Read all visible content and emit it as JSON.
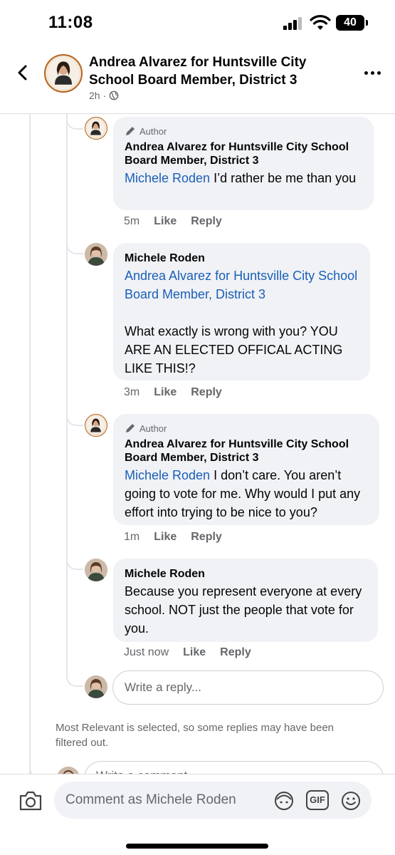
{
  "status_bar": {
    "time": "11:08",
    "battery": "40"
  },
  "header": {
    "title": "Andrea Alvarez for Huntsville City School Board Member, District 3",
    "time_ago": "2h",
    "separator": "·"
  },
  "comments": [
    {
      "badge": "Author",
      "name": "Andrea Alvarez for Huntsville City School Board Member, District 3",
      "mention": "Michele Roden",
      "text": " I’d rather be me than you",
      "time": "5m",
      "like": "Like",
      "reply": "Reply"
    },
    {
      "name": "Michele Roden",
      "mention": "Andrea Alvarez for Huntsville City School Board Member, District 3",
      "text": "What exactly is wrong with you? YOU ARE AN ELECTED OFFICAL ACTING LIKE THIS!?",
      "time": "3m",
      "like": "Like",
      "reply": "Reply"
    },
    {
      "badge": "Author",
      "name": "Andrea Alvarez for Huntsville City School Board Member, District 3",
      "mention": "Michele Roden",
      "text": " I don’t care. You aren’t going to vote for me. Why would I put any effort into trying to be nice to you?",
      "time": "1m",
      "like": "Like",
      "reply": "Reply"
    },
    {
      "name": "Michele Roden",
      "text": "Because you represent everyone at every school. NOT just the people that vote for you.",
      "time": "Just now",
      "like": "Like",
      "reply": "Reply"
    }
  ],
  "reply_box": {
    "placeholder": "Write a reply..."
  },
  "notice": "Most Relevant is selected, so some replies may have been filtered out.",
  "partial_box": {
    "placeholder": "Write a comment..."
  },
  "composer": {
    "placeholder": "Comment as Michele Roden",
    "gif_label": "GIF"
  },
  "icons": [
    "back-icon",
    "globe-icon",
    "more-icon",
    "pencil-icon",
    "camera-icon",
    "avatar-sticker-icon",
    "gif-icon",
    "smiley-icon"
  ],
  "colors": {
    "mention": "#1b5fb8",
    "bubble": "#f0f2f5",
    "muted": "#65676b"
  }
}
